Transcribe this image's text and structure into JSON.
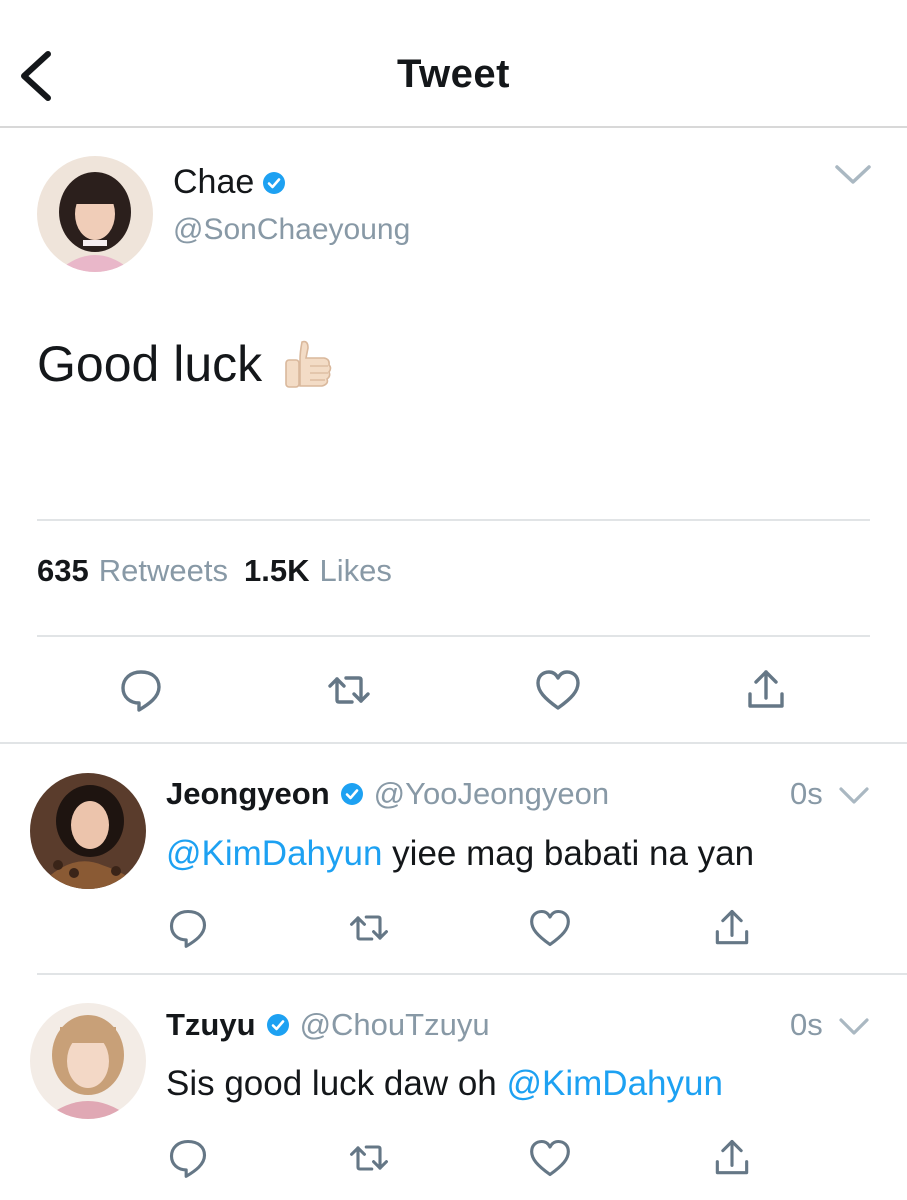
{
  "header": {
    "title": "Tweet"
  },
  "main_tweet": {
    "name": "Chae",
    "handle": "@SonChaeyoung",
    "text": "Good luck",
    "emoji": "thumbs-up",
    "stats": {
      "retweets_count": "635",
      "retweets_label": "Retweets",
      "likes_count": "1.5K",
      "likes_label": "Likes"
    }
  },
  "replies": [
    {
      "name": "Jeongyeon",
      "handle": "@YooJeongyeon",
      "time": "0s",
      "mention": "@KimDahyun",
      "text": " yiee mag babati na yan"
    },
    {
      "name": "Tzuyu",
      "handle": "@ChouTzuyu",
      "time": "0s",
      "text": "Sis good luck daw oh ",
      "mention": "@KimDahyun"
    }
  ],
  "icons": {
    "back": "chevron-left-icon",
    "verified": "verified-badge-icon",
    "caret": "chevron-down-icon",
    "reply": "reply-icon",
    "retweet": "retweet-icon",
    "like": "heart-icon",
    "share": "share-icon"
  },
  "colors": {
    "accent": "#1da1f2",
    "secondary_text": "#8899a6",
    "icon_gray": "#657786",
    "divider": "#e1e4e6"
  }
}
